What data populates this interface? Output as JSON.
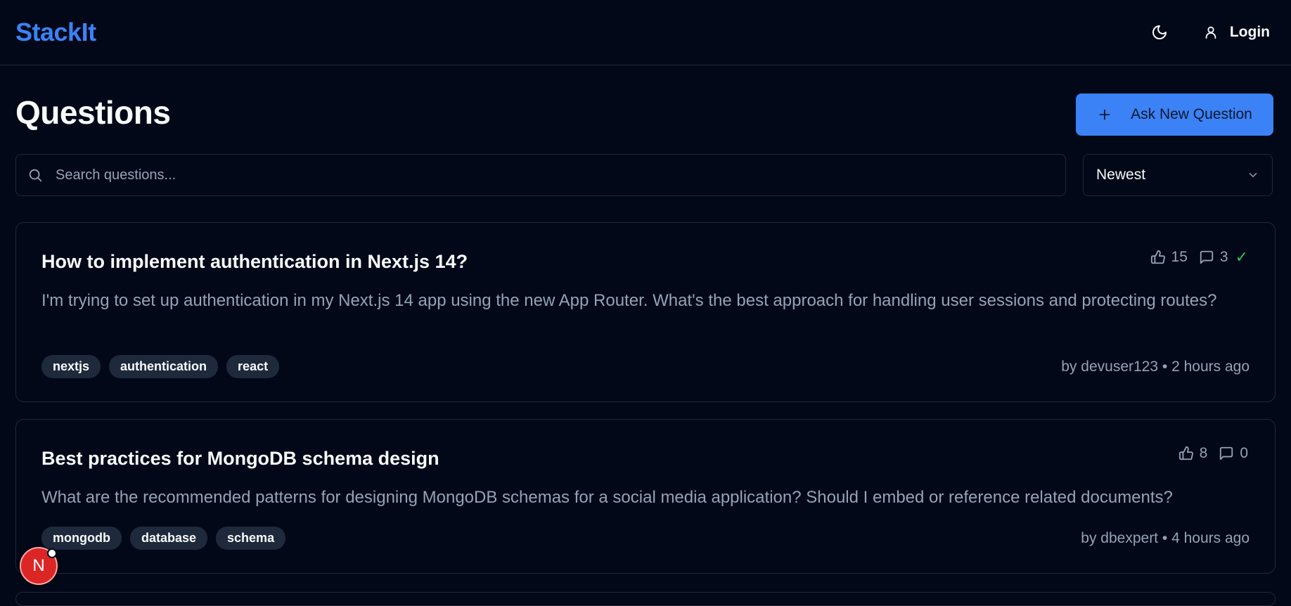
{
  "navbar": {
    "brand": "StackIt",
    "login_label": "Login",
    "theme_icon": "moon-icon",
    "user_icon": "user-icon"
  },
  "page": {
    "title": "Questions",
    "ask_button_label": "Ask New Question"
  },
  "search": {
    "placeholder": "Search questions...",
    "value": ""
  },
  "sort": {
    "selected": "Newest"
  },
  "questions": [
    {
      "title": "How to implement authentication in Next.js 14?",
      "excerpt": "I'm trying to set up authentication in my Next.js 14 app using the new App Router. What's the best approach for handling user sessions and protecting routes?",
      "votes": "15",
      "answers": "3",
      "accepted_mark": "✓",
      "tags": [
        "nextjs",
        "authentication",
        "react"
      ],
      "by": "by",
      "author": "devuser123",
      "separator": "•",
      "time": "2 hours ago"
    },
    {
      "title": "Best practices for MongoDB schema design",
      "excerpt": "What are the recommended patterns for designing MongoDB schemas for a social media application? Should I embed or reference related documents?",
      "votes": "8",
      "answers": "0",
      "tags": [
        "mongodb",
        "database",
        "schema"
      ],
      "by": "by",
      "author": "dbexpert",
      "separator": "•",
      "time": "4 hours ago"
    }
  ],
  "dev_indicator": {
    "letter": "N"
  },
  "colors": {
    "background": "#020817",
    "accent": "#3b82f6",
    "border": "#1e293b",
    "muted_text": "#94a3b8",
    "accepted": "#22c55e",
    "dev_badge": "#dc2626"
  }
}
